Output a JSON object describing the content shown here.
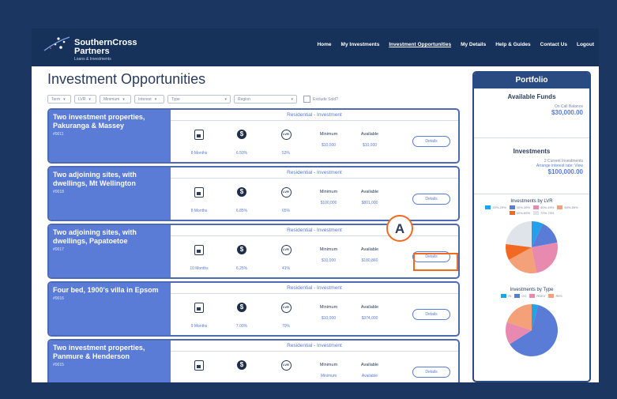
{
  "app": {
    "brand_line1": "SouthernCross",
    "brand_line2": "Partners",
    "brand_tagline": "Loans & Investments"
  },
  "nav": [
    {
      "label": "Home",
      "active": false
    },
    {
      "label": "My Investments",
      "active": false
    },
    {
      "label": "Investment Opportunities",
      "active": true
    },
    {
      "label": "My Details",
      "active": false
    },
    {
      "label": "Help & Guides",
      "active": false
    },
    {
      "label": "Contact Us",
      "active": false
    },
    {
      "label": "Logout",
      "active": false
    }
  ],
  "page": {
    "title": "Investment Opportunities"
  },
  "filters": {
    "items": [
      "Term",
      "LVR",
      "Minimum",
      "Interest",
      "Type",
      "Region"
    ],
    "exclude_label": "Exclude Sold?"
  },
  "metric_labels": {
    "minimum": "Minimum",
    "available": "Available"
  },
  "cards": [
    {
      "title": "Two investment properties, Pakuranga & Massey",
      "ref": "#0011",
      "type": "Residential - Investment",
      "term": "8 Months",
      "rate": "6.50%",
      "lvr": "53%",
      "minimum": "$10,000",
      "available": "$10,000",
      "button": "Details"
    },
    {
      "title": "Two adjoining sites, with dwellings, Mt Wellington",
      "ref": "#0018",
      "type": "Residential - Investment",
      "term": "8 Months",
      "rate": "6.85%",
      "lvr": "65%",
      "minimum": "$100,000",
      "available": "$801,000",
      "button": "Details"
    },
    {
      "title": "Two adjoining sites, with dwellings, Papatoetoe",
      "ref": "#0017",
      "type": "Residential - Investment",
      "term": "10 Months",
      "rate": "6.25%",
      "lvr": "41%",
      "minimum": "$10,000",
      "available": "$180,860",
      "button": "Details"
    },
    {
      "title": "Four bed, 1900's villa in Epsom",
      "ref": "#0016",
      "type": "Residential - Investment",
      "term": "9 Months",
      "rate": "7.00%",
      "lvr": "70%",
      "minimum": "$10,000",
      "available": "$374,000",
      "button": "Details"
    },
    {
      "title": "Two investment properties, Panmure & Henderson",
      "ref": "#0015",
      "type": "Residential - Investment",
      "term": "",
      "rate": "",
      "lvr": "",
      "minimum": "Minimum",
      "available": "Available",
      "button": "Details"
    }
  ],
  "portfolio": {
    "header": "Portfolio",
    "available_funds_title": "Available Funds",
    "call_balance_label": "On Call Balance",
    "call_balance": "$30,000.00",
    "investments_title": "Investments",
    "current_investments": "2 Current Investments",
    "view_link": "Arrange interest rate: View",
    "investments_total": "$100,000.00",
    "chart1_title": "Investments by LVR",
    "chart1_legend": [
      "20%-29%",
      "30%-39%",
      "40%-49%",
      "50%-59%",
      "60%-69%",
      "70%-79%"
    ],
    "chart2_title": "Investments by Type",
    "chart2_legend": [
      "IN",
      "CO",
      "RDEV",
      "RES"
    ]
  },
  "colors": {
    "accent": "#5a7bd6",
    "navy": "#16315a",
    "annotation": "#f26a21"
  },
  "chart_data": [
    {
      "type": "pie",
      "title": "Investments by LVR",
      "categories": [
        "20%-29%",
        "30%-39%",
        "40%-49%",
        "50%-59%",
        "60%-69%",
        "70%-79%"
      ],
      "values": [
        7,
        15,
        25,
        20,
        10,
        23
      ],
      "colors": [
        "#1fa2e8",
        "#5a7bd6",
        "#e88ab0",
        "#f4a078",
        "#f26a21",
        "#dfe3ea"
      ]
    },
    {
      "type": "pie",
      "title": "Investments by Type",
      "categories": [
        "IN",
        "CO",
        "RDEV",
        "RES"
      ],
      "values": [
        4,
        62,
        14,
        20
      ],
      "colors": [
        "#1fa2e8",
        "#5a7bd6",
        "#e88ab0",
        "#f4a078"
      ]
    }
  ],
  "annotation": {
    "label": "A"
  }
}
